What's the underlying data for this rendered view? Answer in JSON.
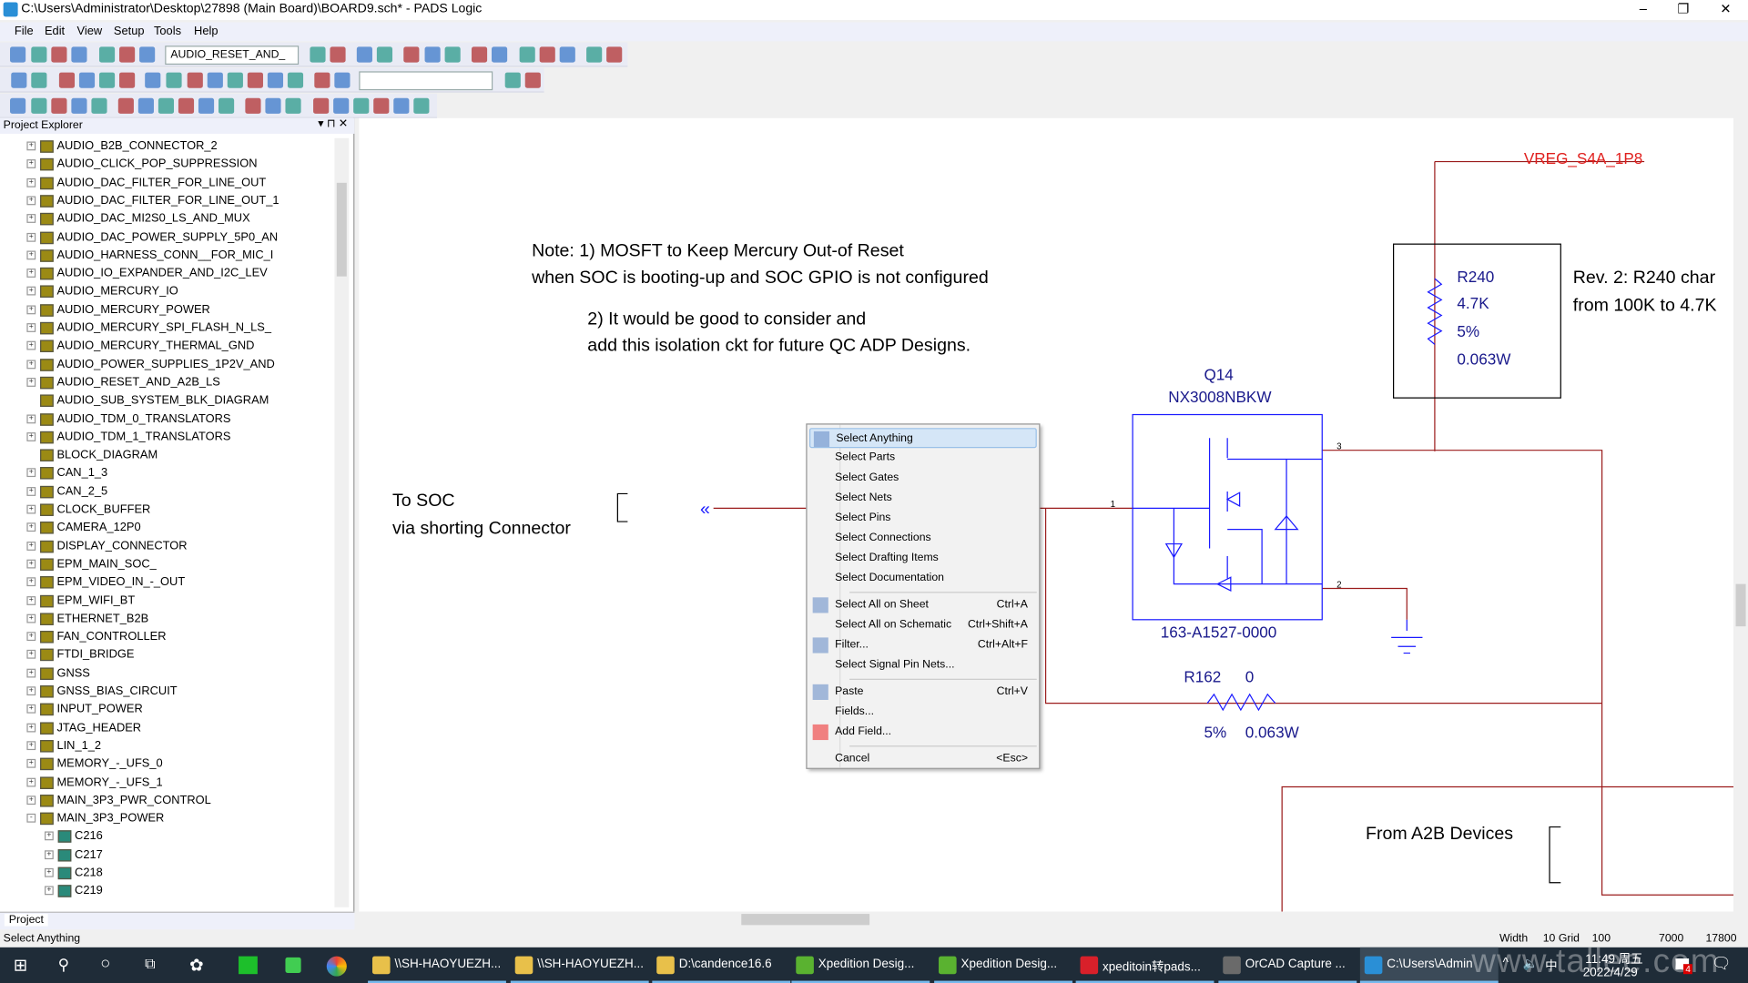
{
  "window": {
    "title": "C:\\Users\\Administrator\\Desktop\\27898 (Main Board)\\BOARD9.sch* - PADS Logic",
    "minimize": "–",
    "restore": "❐",
    "close": "✕"
  },
  "menubar": [
    "File",
    "Edit",
    "View",
    "Setup",
    "Tools",
    "Help"
  ],
  "toolbar": {
    "sheet_combo": "AUDIO_RESET_AND_",
    "empty_combo": ""
  },
  "explorer": {
    "title": "Project Explorer",
    "tab": "Project",
    "items": [
      {
        "label": "AUDIO_B2B_CONNECTOR_2",
        "exp": "+"
      },
      {
        "label": "AUDIO_CLICK_POP_SUPPRESSION",
        "exp": "+"
      },
      {
        "label": "AUDIO_DAC_FILTER_FOR_LINE_OUT",
        "exp": "+"
      },
      {
        "label": "AUDIO_DAC_FILTER_FOR_LINE_OUT_1",
        "exp": "+"
      },
      {
        "label": "AUDIO_DAC_MI2S0_LS_AND_MUX",
        "exp": "+"
      },
      {
        "label": "AUDIO_DAC_POWER_SUPPLY_5P0_AN",
        "exp": "+"
      },
      {
        "label": "AUDIO_HARNESS_CONN__FOR_MIC_I",
        "exp": "+"
      },
      {
        "label": "AUDIO_IO_EXPANDER_AND_I2C_LEV",
        "exp": "+"
      },
      {
        "label": "AUDIO_MERCURY_IO",
        "exp": "+"
      },
      {
        "label": "AUDIO_MERCURY_POWER",
        "exp": "+"
      },
      {
        "label": "AUDIO_MERCURY_SPI_FLASH_N_LS_",
        "exp": "+"
      },
      {
        "label": "AUDIO_MERCURY_THERMAL_GND",
        "exp": "+"
      },
      {
        "label": "AUDIO_POWER_SUPPLIES_1P2V_AND",
        "exp": "+"
      },
      {
        "label": "AUDIO_RESET_AND_A2B_LS",
        "exp": "+"
      },
      {
        "label": "AUDIO_SUB_SYSTEM_BLK_DIAGRAM",
        "exp": ""
      },
      {
        "label": "AUDIO_TDM_0_TRANSLATORS",
        "exp": "+"
      },
      {
        "label": "AUDIO_TDM_1_TRANSLATORS",
        "exp": "+"
      },
      {
        "label": "BLOCK_DIAGRAM",
        "exp": ""
      },
      {
        "label": "CAN_1_3",
        "exp": "+"
      },
      {
        "label": "CAN_2_5",
        "exp": "+"
      },
      {
        "label": "CLOCK_BUFFER",
        "exp": "+"
      },
      {
        "label": "CAMERA_12P0",
        "exp": "+"
      },
      {
        "label": "DISPLAY_CONNECTOR",
        "exp": "+"
      },
      {
        "label": "EPM_MAIN_SOC_",
        "exp": "+"
      },
      {
        "label": "EPM_VIDEO_IN_-_OUT",
        "exp": "+"
      },
      {
        "label": "EPM_WIFI_BT",
        "exp": "+"
      },
      {
        "label": "ETHERNET_B2B",
        "exp": "+"
      },
      {
        "label": "FAN_CONTROLLER",
        "exp": "+"
      },
      {
        "label": "FTDI_BRIDGE",
        "exp": "+"
      },
      {
        "label": "GNSS",
        "exp": "+"
      },
      {
        "label": "GNSS_BIAS_CIRCUIT",
        "exp": "+"
      },
      {
        "label": "INPUT_POWER",
        "exp": "+"
      },
      {
        "label": "JTAG_HEADER",
        "exp": "+"
      },
      {
        "label": "LIN_1_2",
        "exp": "+"
      },
      {
        "label": "MEMORY_-_UFS_0",
        "exp": "+"
      },
      {
        "label": "MEMORY_-_UFS_1",
        "exp": "+"
      },
      {
        "label": "MAIN_3P3_PWR_CONTROL",
        "exp": "+"
      },
      {
        "label": "MAIN_3P3_POWER",
        "exp": "-"
      },
      {
        "label": "C216",
        "exp": "+",
        "child": true
      },
      {
        "label": "C217",
        "exp": "+",
        "child": true
      },
      {
        "label": "C218",
        "exp": "+",
        "child": true
      },
      {
        "label": "C219",
        "exp": "+",
        "child": true
      }
    ]
  },
  "schematic": {
    "note1a": "Note: 1) MOSFT to Keep Mercury Out-of Reset",
    "note1b": "when SOC is booting-up and SOC GPIO is not configured",
    "note2a": "2) It would be good to consider and",
    "note2b": "add this isolation ckt for future QC ADP Designs.",
    "vreg": "VREG_S4A_1P8",
    "r240": {
      "ref": "R240",
      "value": "4.7K",
      "tol": "5%",
      "power": "0.063W"
    },
    "rev1": "Rev. 2: R240 char",
    "rev2": "from 100K to 4.7K",
    "q14": {
      "ref": "Q14",
      "part": "NX3008NBKW",
      "pn": "163-A1527-0000",
      "pin1": "1",
      "pin2": "2",
      "pin3": "3"
    },
    "r162": {
      "ref": "R162",
      "value": "0",
      "tol": "5%",
      "power": "0.063W"
    },
    "tosoc1": "To SOC",
    "tosoc2": "via shorting Connector",
    "offpage": "«",
    "froma2b": "From A2B Devices",
    "colors": {
      "wire": "#9b1c1c",
      "part": "#1a1aff",
      "net_label": "#e0201e"
    }
  },
  "context_menu": [
    {
      "label": "Select Anything",
      "shortcut": "",
      "icon": "select-anything-icon",
      "hl": true
    },
    {
      "label": "Select Parts",
      "shortcut": ""
    },
    {
      "label": "Select Gates",
      "shortcut": ""
    },
    {
      "label": "Select Nets",
      "shortcut": ""
    },
    {
      "label": "Select Pins",
      "shortcut": ""
    },
    {
      "label": "Select Connections",
      "shortcut": ""
    },
    {
      "label": "Select Drafting Items",
      "shortcut": ""
    },
    {
      "label": "Select Documentation",
      "shortcut": ""
    },
    {
      "sep": true
    },
    {
      "label": "Select All on Sheet",
      "shortcut": "Ctrl+A",
      "icon": "select-all-icon"
    },
    {
      "label": "Select All on Schematic",
      "shortcut": "Ctrl+Shift+A"
    },
    {
      "label": "Filter...",
      "shortcut": "Ctrl+Alt+F",
      "icon": "filter-icon"
    },
    {
      "label": "Select Signal Pin Nets...",
      "shortcut": ""
    },
    {
      "sep": true
    },
    {
      "label": "Paste",
      "shortcut": "Ctrl+V",
      "icon": "paste-icon"
    },
    {
      "label": "Fields...",
      "shortcut": ""
    },
    {
      "label": "Add Field...",
      "shortcut": "",
      "icon": "add-field-icon"
    },
    {
      "sep": true
    },
    {
      "label": "Cancel",
      "shortcut": "<Esc>"
    }
  ],
  "statusbar": {
    "text": "Select Anything",
    "width_label": "Width",
    "width": "10",
    "grid_label": "Grid",
    "grid": "100",
    "x": "7000",
    "y": "17800"
  },
  "taskbar": {
    "tasks": [
      {
        "label": "\\\\SH-HAOYUEZH...",
        "color": "#e8c04a"
      },
      {
        "label": "\\\\SH-HAOYUEZH...",
        "color": "#e8c04a"
      },
      {
        "label": "D:\\candence16.6",
        "color": "#e8c04a"
      },
      {
        "label": "Xpedition Desig...",
        "color": "#5ab230"
      },
      {
        "label": "Xpedition Desig...",
        "color": "#5ab230"
      },
      {
        "label": "xpeditoin转pads...",
        "color": "#d8202a"
      },
      {
        "label": "OrCAD Capture ...",
        "color": "#6a6a6a"
      },
      {
        "label": "C:\\Users\\Admin",
        "color": "#2a8fd6"
      }
    ],
    "time": "11:49 周五",
    "date": "2022/4/29",
    "ime": "中",
    "notif_count": "4",
    "watermark": "www.tallee.com"
  }
}
